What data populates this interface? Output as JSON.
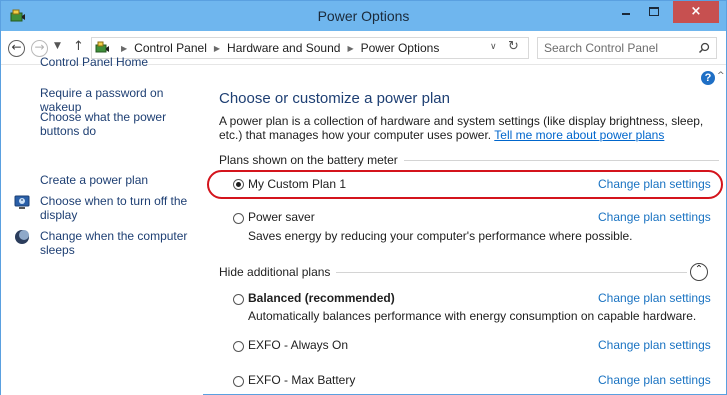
{
  "window": {
    "title": "Power Options",
    "close_glyph": "×"
  },
  "toolbar": {
    "breadcrumbs": [
      "Control Panel",
      "Hardware and Sound",
      "Power Options"
    ],
    "search_placeholder": "Search Control Panel"
  },
  "sidebar": {
    "home_label": "Control Panel Home",
    "items": [
      {
        "label": "Require a password on wakeup",
        "icon": null
      },
      {
        "label": "Choose what the power buttons do",
        "icon": null
      },
      {
        "label": "Create a power plan",
        "icon": null
      },
      {
        "label": "Choose when to turn off the display",
        "icon": "monitor-icon"
      },
      {
        "label": "Change when the computer sleeps",
        "icon": "moon-icon"
      }
    ]
  },
  "main": {
    "title": "Choose or customize a power plan",
    "description": "A power plan is a collection of hardware and system settings (like display brightness, sleep, etc.) that manages how your computer uses power.",
    "description_link": "Tell me more about power plans",
    "battery_group_label": "Plans shown on the battery meter",
    "hidden_group_label": "Hide additional plans",
    "change_link_label": "Change plan settings",
    "plans": [
      {
        "name": "My Custom Plan 1",
        "selected": true,
        "bold": false,
        "description": ""
      },
      {
        "name": "Power saver",
        "selected": false,
        "bold": false,
        "description": "Saves energy by reducing your computer's performance where possible."
      },
      {
        "name": "Balanced (recommended)",
        "selected": false,
        "bold": true,
        "description": "Automatically balances performance with energy consumption on capable hardware."
      },
      {
        "name": "EXFO - Always On",
        "selected": false,
        "bold": false,
        "description": ""
      },
      {
        "name": "EXFO - Max Battery",
        "selected": false,
        "bold": false,
        "description": ""
      }
    ]
  },
  "colors": {
    "titlebar": "#6fb6ee",
    "link": "#1a73c2",
    "heading": "#1e3f73",
    "highlight": "#d4141c",
    "close_button": "#c75050"
  }
}
